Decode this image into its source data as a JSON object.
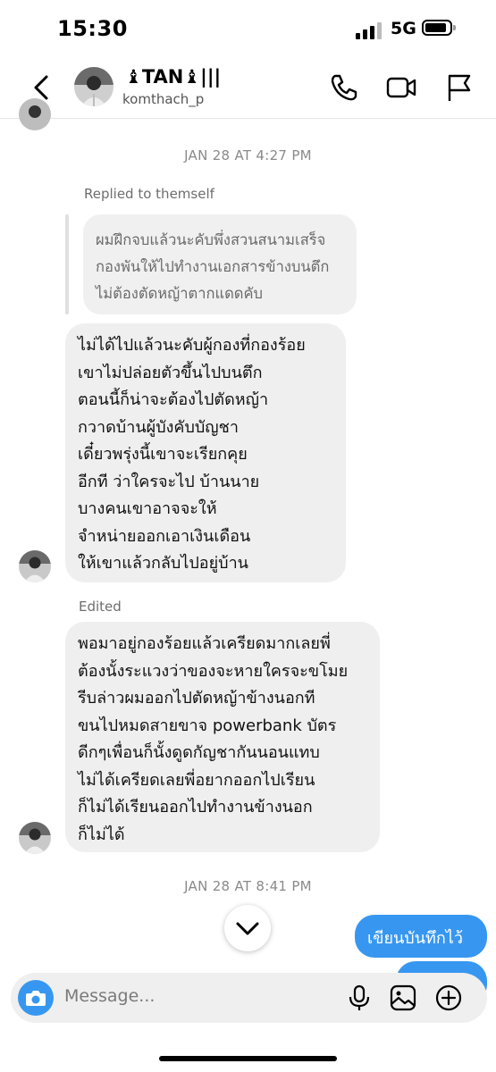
{
  "status_bar": {
    "time": "15:30",
    "network": "5G"
  },
  "header": {
    "name": "♝TAN♝|||",
    "username": "komthach_p"
  },
  "messages": {
    "timestamp_1": "JAN 28 AT 4:27 PM",
    "replied_label": "Replied to themself",
    "reply_quote_lines": [
      "ผมฝึกจบแล้วนะคับพึ่งสวนสนามเสร็จ",
      "กองพันให้ไปทำงานเอกสารข้างบนตึก",
      "ไม่ต้องตัดหญ้าตากแดดคับ"
    ],
    "bubble_1_lines": [
      "ไม่ได้ไปแล้วนะคับผู้กองที่กองร้อย",
      "เขาไม่ปล่อยตัวขึ้นไปบนตึก",
      "ตอนนี้ก็น่าจะต้องไปตัดหญ้า",
      "กวาดบ้านผู้บังคับบัญชา",
      "เดี๋ยวพรุ่งนี้เขาจะเรียกคุย",
      "อีกที ว่าใครจะไป บ้านนาย",
      "บางคนเขาอาจจะให้",
      "จำหน่ายออกเอาเงินเดือน",
      "ให้เขาแล้วกลับไปอยู่บ้าน"
    ],
    "edited_label": "Edited",
    "bubble_2_lines": [
      "พอมาอยู่กองร้อยแล้วเครียดมากเลยพี่",
      "ต้องนั้งระแวงว่าของจะหายใครจะขโมย",
      "รีบล่าวผมออกไปตัดหญ้าข้างนอกที",
      "ขนไปหมดสายขาจ powerbank บัตร",
      "ดีกๆเพื่อนก็นั้งดูดกัญชากันนอนแทบ",
      "ไม่ได้เครียดเลยพี่อยากออกไปเรียน",
      "ก็ไม่ได้เรียนออกไปทำงานข้างนอก",
      "ก็ไม่ได้"
    ],
    "timestamp_2": "JAN 28 AT 8:41 PM",
    "outgoing_1": "เขียนบันทึกไว้"
  },
  "composer": {
    "placeholder": "Message..."
  },
  "icons": {
    "back": "chevron-left-icon",
    "call": "phone-icon",
    "video": "video-camera-icon",
    "report": "flag-icon",
    "scroll_down": "chevron-down-icon",
    "camera": "camera-icon",
    "mic": "microphone-icon",
    "gallery": "image-icon",
    "add": "plus-circle-icon"
  },
  "colors": {
    "accent": "#3797f0",
    "incoming_bubble": "#efefef",
    "reply_bubble": "#f0f0f0"
  }
}
